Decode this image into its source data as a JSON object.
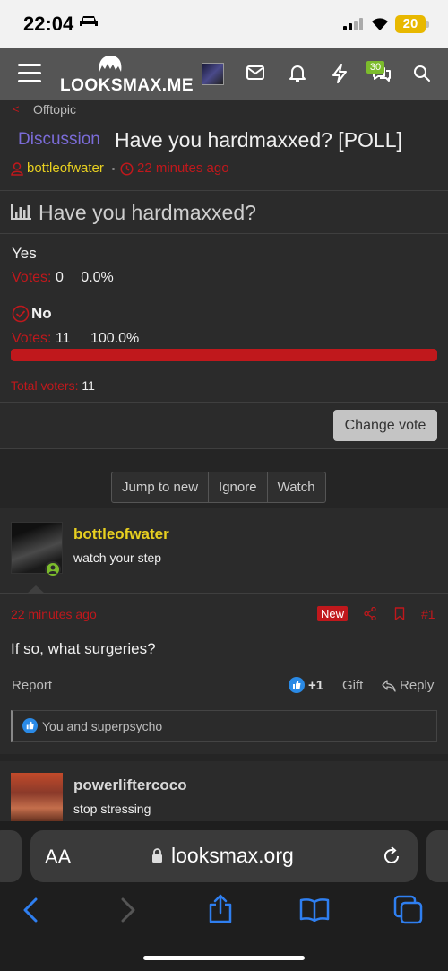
{
  "status_bar": {
    "time": "22:04",
    "battery": "20"
  },
  "header": {
    "logo": "LOOKSMAX.ME",
    "conversations_badge": "30"
  },
  "breadcrumb": {
    "label": "Offtopic"
  },
  "thread": {
    "prefix": "Discussion",
    "title": "Have you hardmaxxed? [POLL]",
    "author": "bottleofwater",
    "time": "22 minutes ago"
  },
  "poll": {
    "question": "Have you hardmaxxed?",
    "votes_label": "Votes:",
    "options": [
      {
        "label": "Yes",
        "votes": "0",
        "percent": "0.0%",
        "fraction": 0.0
      },
      {
        "label": "No",
        "votes": "11",
        "percent": "100.0%",
        "fraction": 1.0
      }
    ],
    "total_label": "Total voters:",
    "total_value": "11",
    "change_vote_label": "Change vote"
  },
  "thread_actions": {
    "jump": "Jump to new",
    "ignore": "Ignore",
    "watch": "Watch"
  },
  "post": {
    "author": "bottleofwater",
    "user_title": "watch your step",
    "time": "22 minutes ago",
    "new_badge": "New",
    "number": "#1",
    "body": "If so, what surgeries?",
    "report": "Report",
    "reaction_count": "+1",
    "gift": "Gift",
    "reply": "Reply",
    "reactions_text": "You and superpsycho"
  },
  "next_post": {
    "author": "powerliftercoco",
    "user_title": "stop stressing"
  },
  "safari": {
    "aa": "AA",
    "url": "looksmax.org"
  },
  "colors": {
    "accent_red": "#c0181c",
    "username_yellow": "#e8d020",
    "prefix_purple": "#7b6cd8",
    "header_gray": "#555555"
  }
}
